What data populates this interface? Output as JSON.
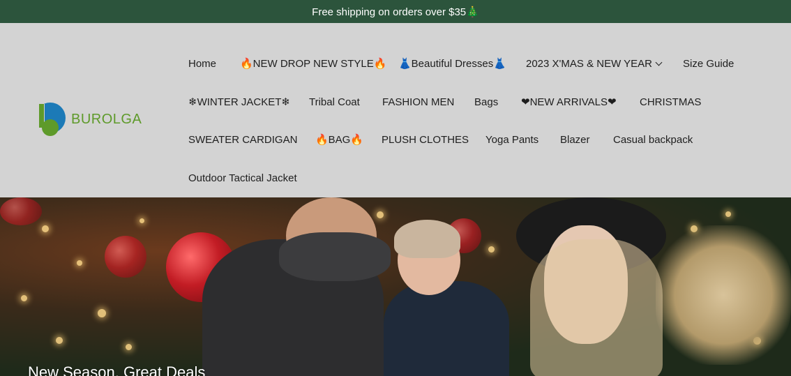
{
  "announcement": {
    "text": "Free shipping on orders over $35🎄"
  },
  "brand": {
    "name": "BUROLGA",
    "colors": {
      "green": "#5e9a2a",
      "blue": "#1c7ab7"
    }
  },
  "colors": {
    "announce_bg": "#2c543c",
    "header_bg": "#d3d3d3",
    "nav_text": "#1e1e1e"
  },
  "nav": {
    "items": [
      {
        "label": "Home"
      },
      {
        "label": "🔥NEW DROP NEW STYLE🔥"
      },
      {
        "label": "👗Beautiful Dresses👗"
      },
      {
        "label": "2023 X'MAS & NEW YEAR",
        "has_dropdown": true,
        "icon": "chevron-down-icon"
      },
      {
        "label": "Size Guide"
      },
      {
        "label": "❄WINTER JACKET❄"
      },
      {
        "label": "Tribal Coat"
      },
      {
        "label": "FASHION MEN"
      },
      {
        "label": "Bags"
      },
      {
        "label": "❤NEW ARRIVALS❤"
      },
      {
        "label": "CHRISTMAS"
      },
      {
        "label": "SWEATER CARDIGAN"
      },
      {
        "label": "🔥BAG🔥"
      },
      {
        "label": "PLUSH CLOTHES"
      },
      {
        "label": "Yoga Pants"
      },
      {
        "label": "Blazer"
      },
      {
        "label": "Casual backpack"
      },
      {
        "label": "Outdoor Tactical Jacket"
      }
    ]
  },
  "hero": {
    "heading": "New Season, Great Deals"
  }
}
